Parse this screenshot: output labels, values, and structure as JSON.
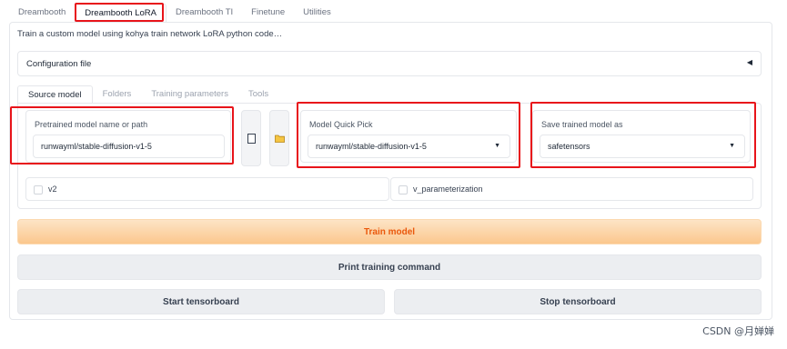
{
  "top_tabs": [
    "Dreambooth",
    "Dreambooth LoRA",
    "Dreambooth TI",
    "Finetune",
    "Utilities"
  ],
  "description": "Train a custom model using kohya train network LoRA python code…",
  "config": {
    "label": "Configuration file",
    "arrow": "◀"
  },
  "sub_tabs": [
    "Source model",
    "Folders",
    "Training parameters",
    "Tools"
  ],
  "source_model": {
    "pretrained_label": "Pretrained model name or path",
    "pretrained_value": "runwayml/stable-diffusion-v1-5",
    "quick_pick_label": "Model Quick Pick",
    "quick_pick_value": "runwayml/stable-diffusion-v1-5",
    "save_as_label": "Save trained model as",
    "save_as_value": "safetensors",
    "dropdown_arrow": "▼",
    "checkbox_v2": "v2",
    "checkbox_v_param": "v_parameterization"
  },
  "buttons": {
    "train": "Train model",
    "print": "Print training command",
    "start_tb": "Start tensorboard",
    "stop_tb": "Stop tensorboard"
  },
  "watermark": "CSDN @月婵婵",
  "colors": {
    "highlight": "#e8141a",
    "primary_text": "#ea580c"
  },
  "icons": {
    "file_button": "document-icon",
    "folder_button": "folder-icon"
  }
}
